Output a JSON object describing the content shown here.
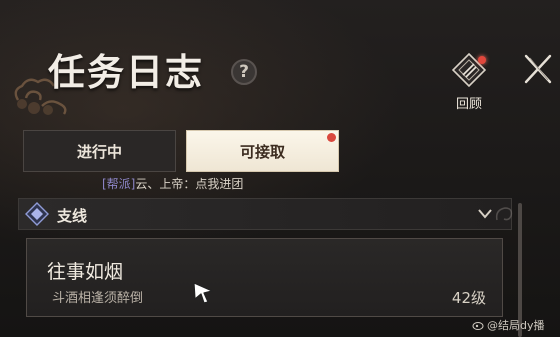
{
  "header": {
    "title": "任务日志",
    "help_symbol": "?"
  },
  "review": {
    "label": "回顾",
    "has_notification": true
  },
  "tabs": [
    {
      "label": "进行中",
      "active": true
    },
    {
      "label": "可接取",
      "active": false,
      "has_notification": true
    }
  ],
  "chat": {
    "channel": "[帮派]",
    "message": "云、上帝：点我进团"
  },
  "category": {
    "label": "支线",
    "icon": "diamond-emblem-icon",
    "expanded": true
  },
  "quests": [
    {
      "title": "往事如烟",
      "subtitle": "斗酒相逢须醉倒",
      "level": "42级"
    }
  ],
  "watermark": {
    "text": "@结局dy播"
  },
  "colors": {
    "background": "#1a1817",
    "accent_cream": "#f3ecde",
    "notification_red": "#d9483e",
    "channel_purple": "#8d86c8"
  }
}
